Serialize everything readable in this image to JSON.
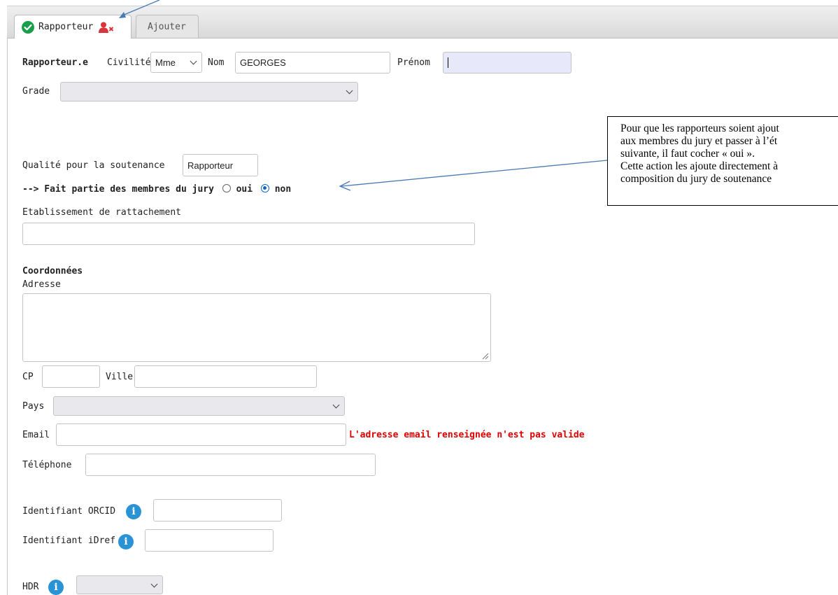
{
  "tabs": {
    "active_label": "Rapporteur",
    "inactive_label": "Ajouter"
  },
  "form": {
    "section_title": "Rapporteur.e",
    "civilite_label": "Civilité",
    "civilite_value": "Mme",
    "nom_label": "Nom",
    "nom_value": "GEORGES",
    "prenom_label": "Prénom",
    "prenom_value": "",
    "grade_label": "Grade",
    "grade_value": "",
    "qualite_label": "Qualité pour la soutenance",
    "qualite_value": "Rapporteur",
    "jury_question": "--> Fait partie des membres du jury",
    "jury_oui": "oui",
    "jury_non": "non",
    "jury_selected": "non",
    "etablissement_label": "Etablissement de rattachement",
    "etablissement_value": "",
    "coordonnees_title": "Coordonnées",
    "adresse_label": "Adresse",
    "adresse_value": "",
    "cp_label": "CP",
    "cp_value": "",
    "ville_label": "Ville",
    "ville_value": "",
    "pays_label": "Pays",
    "pays_value": "",
    "email_label": "Email",
    "email_value": "",
    "email_error": "L'adresse email renseignée n'est pas valide",
    "telephone_label": "Téléphone",
    "telephone_value": "",
    "orcid_label": "Identifiant ORCID",
    "orcid_value": "",
    "idref_label": "Identifiant iDref",
    "idref_value": "",
    "hdr_label": "HDR",
    "hdr_value": ""
  },
  "annotation": {
    "lines": [
      "Pour que les rapporteurs soient ajout",
      "aux membres du jury et passer à l’ét",
      "suivante, il faut cocher « oui ».",
      "Cette action les ajoute directement à",
      "composition du jury de soutenance"
    ]
  },
  "colors": {
    "check_icon": "#1a9e4a",
    "user_remove_icon": "#d9343a",
    "info_icon": "#2a93d5",
    "error_text": "#e00000",
    "arrow": "#4a7ab5"
  },
  "icons": {
    "tab_status": "check-circle-icon",
    "tab_action": "user-remove-icon",
    "info": "info-icon"
  }
}
